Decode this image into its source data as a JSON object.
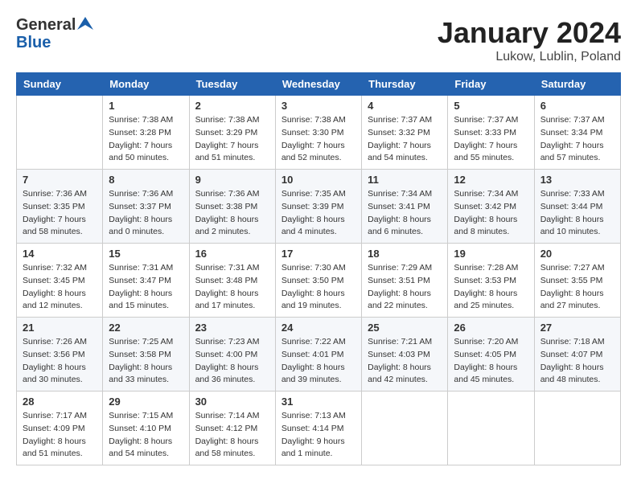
{
  "header": {
    "logo_general": "General",
    "logo_blue": "Blue",
    "month_title": "January 2024",
    "location": "Lukow, Lublin, Poland"
  },
  "days_of_week": [
    "Sunday",
    "Monday",
    "Tuesday",
    "Wednesday",
    "Thursday",
    "Friday",
    "Saturday"
  ],
  "weeks": [
    [
      {
        "num": "",
        "sunrise": "",
        "sunset": "",
        "daylight": ""
      },
      {
        "num": "1",
        "sunrise": "Sunrise: 7:38 AM",
        "sunset": "Sunset: 3:28 PM",
        "daylight": "Daylight: 7 hours and 50 minutes."
      },
      {
        "num": "2",
        "sunrise": "Sunrise: 7:38 AM",
        "sunset": "Sunset: 3:29 PM",
        "daylight": "Daylight: 7 hours and 51 minutes."
      },
      {
        "num": "3",
        "sunrise": "Sunrise: 7:38 AM",
        "sunset": "Sunset: 3:30 PM",
        "daylight": "Daylight: 7 hours and 52 minutes."
      },
      {
        "num": "4",
        "sunrise": "Sunrise: 7:37 AM",
        "sunset": "Sunset: 3:32 PM",
        "daylight": "Daylight: 7 hours and 54 minutes."
      },
      {
        "num": "5",
        "sunrise": "Sunrise: 7:37 AM",
        "sunset": "Sunset: 3:33 PM",
        "daylight": "Daylight: 7 hours and 55 minutes."
      },
      {
        "num": "6",
        "sunrise": "Sunrise: 7:37 AM",
        "sunset": "Sunset: 3:34 PM",
        "daylight": "Daylight: 7 hours and 57 minutes."
      }
    ],
    [
      {
        "num": "7",
        "sunrise": "Sunrise: 7:36 AM",
        "sunset": "Sunset: 3:35 PM",
        "daylight": "Daylight: 7 hours and 58 minutes."
      },
      {
        "num": "8",
        "sunrise": "Sunrise: 7:36 AM",
        "sunset": "Sunset: 3:37 PM",
        "daylight": "Daylight: 8 hours and 0 minutes."
      },
      {
        "num": "9",
        "sunrise": "Sunrise: 7:36 AM",
        "sunset": "Sunset: 3:38 PM",
        "daylight": "Daylight: 8 hours and 2 minutes."
      },
      {
        "num": "10",
        "sunrise": "Sunrise: 7:35 AM",
        "sunset": "Sunset: 3:39 PM",
        "daylight": "Daylight: 8 hours and 4 minutes."
      },
      {
        "num": "11",
        "sunrise": "Sunrise: 7:34 AM",
        "sunset": "Sunset: 3:41 PM",
        "daylight": "Daylight: 8 hours and 6 minutes."
      },
      {
        "num": "12",
        "sunrise": "Sunrise: 7:34 AM",
        "sunset": "Sunset: 3:42 PM",
        "daylight": "Daylight: 8 hours and 8 minutes."
      },
      {
        "num": "13",
        "sunrise": "Sunrise: 7:33 AM",
        "sunset": "Sunset: 3:44 PM",
        "daylight": "Daylight: 8 hours and 10 minutes."
      }
    ],
    [
      {
        "num": "14",
        "sunrise": "Sunrise: 7:32 AM",
        "sunset": "Sunset: 3:45 PM",
        "daylight": "Daylight: 8 hours and 12 minutes."
      },
      {
        "num": "15",
        "sunrise": "Sunrise: 7:31 AM",
        "sunset": "Sunset: 3:47 PM",
        "daylight": "Daylight: 8 hours and 15 minutes."
      },
      {
        "num": "16",
        "sunrise": "Sunrise: 7:31 AM",
        "sunset": "Sunset: 3:48 PM",
        "daylight": "Daylight: 8 hours and 17 minutes."
      },
      {
        "num": "17",
        "sunrise": "Sunrise: 7:30 AM",
        "sunset": "Sunset: 3:50 PM",
        "daylight": "Daylight: 8 hours and 19 minutes."
      },
      {
        "num": "18",
        "sunrise": "Sunrise: 7:29 AM",
        "sunset": "Sunset: 3:51 PM",
        "daylight": "Daylight: 8 hours and 22 minutes."
      },
      {
        "num": "19",
        "sunrise": "Sunrise: 7:28 AM",
        "sunset": "Sunset: 3:53 PM",
        "daylight": "Daylight: 8 hours and 25 minutes."
      },
      {
        "num": "20",
        "sunrise": "Sunrise: 7:27 AM",
        "sunset": "Sunset: 3:55 PM",
        "daylight": "Daylight: 8 hours and 27 minutes."
      }
    ],
    [
      {
        "num": "21",
        "sunrise": "Sunrise: 7:26 AM",
        "sunset": "Sunset: 3:56 PM",
        "daylight": "Daylight: 8 hours and 30 minutes."
      },
      {
        "num": "22",
        "sunrise": "Sunrise: 7:25 AM",
        "sunset": "Sunset: 3:58 PM",
        "daylight": "Daylight: 8 hours and 33 minutes."
      },
      {
        "num": "23",
        "sunrise": "Sunrise: 7:23 AM",
        "sunset": "Sunset: 4:00 PM",
        "daylight": "Daylight: 8 hours and 36 minutes."
      },
      {
        "num": "24",
        "sunrise": "Sunrise: 7:22 AM",
        "sunset": "Sunset: 4:01 PM",
        "daylight": "Daylight: 8 hours and 39 minutes."
      },
      {
        "num": "25",
        "sunrise": "Sunrise: 7:21 AM",
        "sunset": "Sunset: 4:03 PM",
        "daylight": "Daylight: 8 hours and 42 minutes."
      },
      {
        "num": "26",
        "sunrise": "Sunrise: 7:20 AM",
        "sunset": "Sunset: 4:05 PM",
        "daylight": "Daylight: 8 hours and 45 minutes."
      },
      {
        "num": "27",
        "sunrise": "Sunrise: 7:18 AM",
        "sunset": "Sunset: 4:07 PM",
        "daylight": "Daylight: 8 hours and 48 minutes."
      }
    ],
    [
      {
        "num": "28",
        "sunrise": "Sunrise: 7:17 AM",
        "sunset": "Sunset: 4:09 PM",
        "daylight": "Daylight: 8 hours and 51 minutes."
      },
      {
        "num": "29",
        "sunrise": "Sunrise: 7:15 AM",
        "sunset": "Sunset: 4:10 PM",
        "daylight": "Daylight: 8 hours and 54 minutes."
      },
      {
        "num": "30",
        "sunrise": "Sunrise: 7:14 AM",
        "sunset": "Sunset: 4:12 PM",
        "daylight": "Daylight: 8 hours and 58 minutes."
      },
      {
        "num": "31",
        "sunrise": "Sunrise: 7:13 AM",
        "sunset": "Sunset: 4:14 PM",
        "daylight": "Daylight: 9 hours and 1 minute."
      },
      {
        "num": "",
        "sunrise": "",
        "sunset": "",
        "daylight": ""
      },
      {
        "num": "",
        "sunrise": "",
        "sunset": "",
        "daylight": ""
      },
      {
        "num": "",
        "sunrise": "",
        "sunset": "",
        "daylight": ""
      }
    ]
  ]
}
